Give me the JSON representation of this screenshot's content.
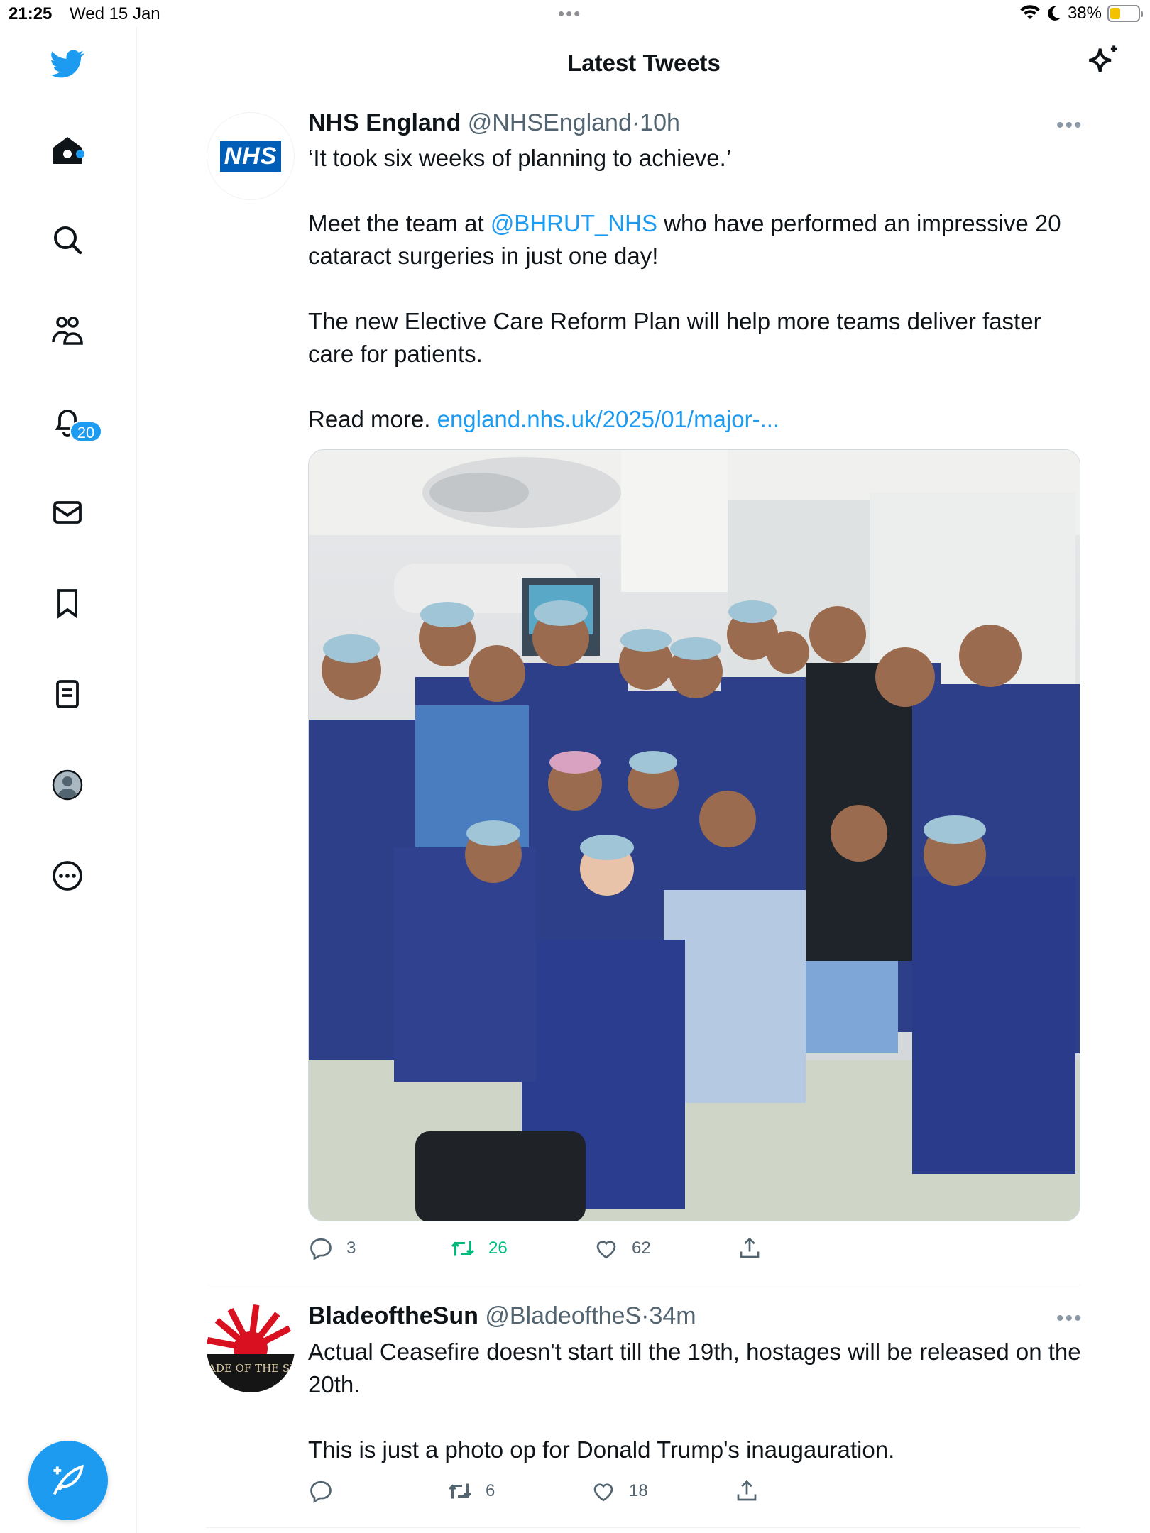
{
  "status_bar": {
    "time": "21:25",
    "date": "Wed 15 Jan",
    "battery_percent": "38%",
    "battery_level": 0.38,
    "icons": [
      "wifi-icon",
      "moon-icon",
      "battery-icon"
    ]
  },
  "header": {
    "title": "Latest Tweets"
  },
  "sidebar": {
    "items": [
      "twitter-logo-icon",
      "home-icon",
      "search-icon",
      "communities-icon",
      "notifications-icon",
      "messages-icon",
      "bookmarks-icon",
      "lists-icon",
      "profile-icon",
      "more-icon"
    ],
    "notifications_badge": "20",
    "compose_icon": "compose-icon"
  },
  "tweets": [
    {
      "name": "NHS England",
      "handle": "@NHSEngland",
      "separator": "·",
      "age": "10h",
      "avatar_text": "NHS",
      "quote": "‘It took six weeks of planning to achieve.’",
      "para2_before": "Meet the team at ",
      "para2_mention": "@BHRUT_NHS",
      "para2_after": " who have performed an impressive 20 cataract surgeries in just one day!",
      "para3": "The new Elective Care Reform Plan will help more teams deliver faster care for patients.",
      "para4_before": "Read more. ",
      "para4_link": "england.nhs.uk/2025/01/major-...",
      "replies": "3",
      "retweets": "26",
      "likes": "62"
    },
    {
      "name": "BladeoftheSun",
      "handle": "@BladeoftheS",
      "separator": "·",
      "age": "34m",
      "avatar_text": "BLADE OF THE SUN",
      "para1": "Actual Ceasefire doesn't start till the 19th, hostages will be released on the 20th.",
      "para2": "This is just a photo op for Donald Trump's inaugauration.",
      "replies": "",
      "retweets": "6",
      "likes": "18"
    }
  ],
  "colors": {
    "accent": "#1d9bf0",
    "retweet_active": "#00ba7c",
    "nhs_blue": "#005eb8",
    "text_secondary": "#536471"
  }
}
